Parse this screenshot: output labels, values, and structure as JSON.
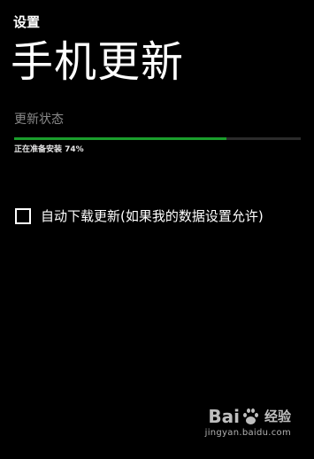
{
  "header": {
    "app_title": "设置",
    "page_title": "手机更新"
  },
  "update": {
    "section_label": "更新状态",
    "progress_status": "正在准备安装 74%",
    "progress_fraction": 0.74,
    "progress_color": "#1a9e2c"
  },
  "options": {
    "auto_download": {
      "label": "自动下载更新(如果我的数据设置允许)",
      "checked": false
    }
  },
  "watermark": {
    "logo_left": "Bai",
    "logo_right": "经验",
    "url": "jingyan.baidu.com"
  }
}
